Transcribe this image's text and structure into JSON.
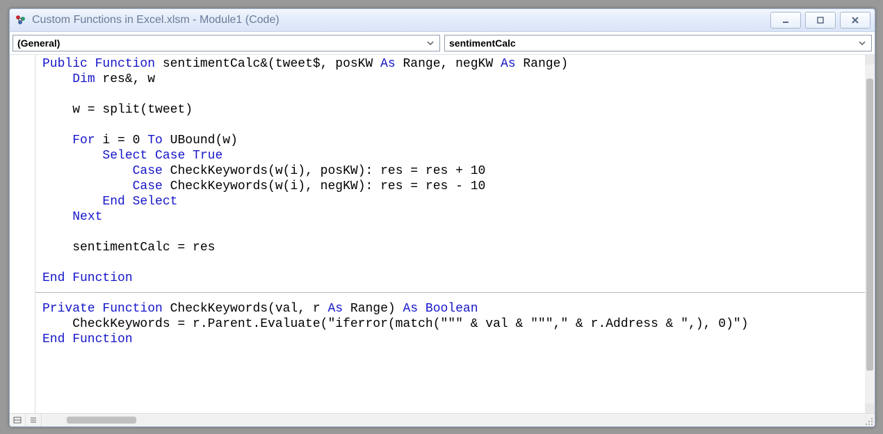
{
  "window": {
    "title": "Custom Functions in Excel.xlsm - Module1 (Code)"
  },
  "dropdowns": {
    "object": "(General)",
    "procedure": "sentimentCalc"
  },
  "code": {
    "lines": [
      [
        {
          "t": "Public Function",
          "c": "kw"
        },
        {
          "t": " sentimentCalc&(tweet$, posKW "
        },
        {
          "t": "As",
          "c": "kw"
        },
        {
          "t": " Range, negKW "
        },
        {
          "t": "As",
          "c": "kw"
        },
        {
          "t": " Range)"
        }
      ],
      [
        {
          "t": "    "
        },
        {
          "t": "Dim",
          "c": "kw"
        },
        {
          "t": " res&, w"
        }
      ],
      [
        {
          "t": ""
        }
      ],
      [
        {
          "t": "    w = split(tweet)"
        }
      ],
      [
        {
          "t": ""
        }
      ],
      [
        {
          "t": "    "
        },
        {
          "t": "For",
          "c": "kw"
        },
        {
          "t": " i = 0 "
        },
        {
          "t": "To",
          "c": "kw"
        },
        {
          "t": " UBound(w)"
        }
      ],
      [
        {
          "t": "        "
        },
        {
          "t": "Select Case True",
          "c": "kw"
        }
      ],
      [
        {
          "t": "            "
        },
        {
          "t": "Case",
          "c": "kw"
        },
        {
          "t": " CheckKeywords(w(i), posKW): res = res + 10"
        }
      ],
      [
        {
          "t": "            "
        },
        {
          "t": "Case",
          "c": "kw"
        },
        {
          "t": " CheckKeywords(w(i), negKW): res = res - 10"
        }
      ],
      [
        {
          "t": "        "
        },
        {
          "t": "End Select",
          "c": "kw"
        }
      ],
      [
        {
          "t": "    "
        },
        {
          "t": "Next",
          "c": "kw"
        }
      ],
      [
        {
          "t": ""
        }
      ],
      [
        {
          "t": "    sentimentCalc = res"
        }
      ],
      [
        {
          "t": ""
        }
      ],
      [
        {
          "t": "End Function",
          "c": "kw"
        }
      ],
      [
        {
          "t": ""
        }
      ],
      [
        {
          "t": "Private Function",
          "c": "kw"
        },
        {
          "t": " CheckKeywords(val, r "
        },
        {
          "t": "As",
          "c": "kw"
        },
        {
          "t": " Range) "
        },
        {
          "t": "As Boolean",
          "c": "kw"
        }
      ],
      [
        {
          "t": "    CheckKeywords = r.Parent.Evaluate(\"iferror(match(\"\"\" & val & \"\"\",\" & r.Address & \",), 0)\")"
        }
      ],
      [
        {
          "t": "End Function",
          "c": "kw"
        }
      ]
    ],
    "separatorAfterLine": 15
  }
}
